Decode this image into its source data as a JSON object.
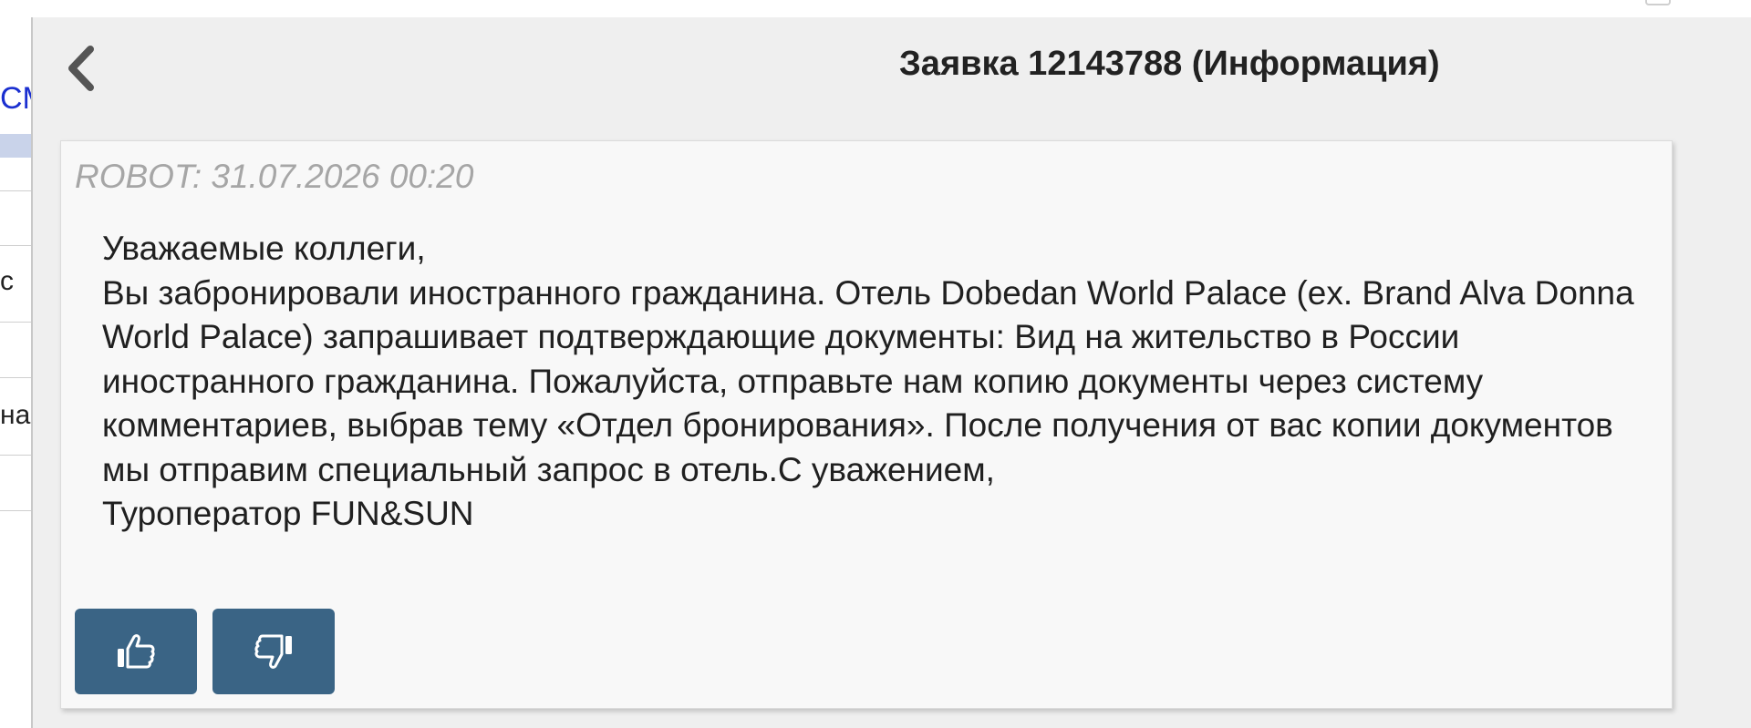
{
  "header": {
    "title": "Заявка 12143788 (Информация)",
    "back_icon": "chevron-left-icon"
  },
  "background_page": {
    "link_text": "CM",
    "text_rows": [
      "с",
      "на"
    ]
  },
  "comment": {
    "author_line": "ROBOT: 31.07.2026 00:20",
    "message_lines": [
      "Уважаемые коллеги,",
      "Вы забронировали иностранного гражданина. Отель Dobedan World Palace (ex. Brand Alva Donna World Palace) запрашивает подтверждающие документы: Вид на жительство в России иностранного гражданина. Пожалуйста, отправьте нам копию документы через систему комментариев, выбрав тему «Отдел бронирования». После получения от вас копии документов мы отправим специальный запрос в отель.С уважением,",
      "Туроператор FUN&SUN"
    ],
    "actions": {
      "like_icon": "thumbs-up-icon",
      "dislike_icon": "thumbs-down-icon"
    }
  },
  "colors": {
    "panel_bg": "#efefef",
    "card_bg": "#f8f8f8",
    "button_bg": "#3a6485",
    "muted_text": "#a6a6a6",
    "link": "#1a2fd0"
  }
}
